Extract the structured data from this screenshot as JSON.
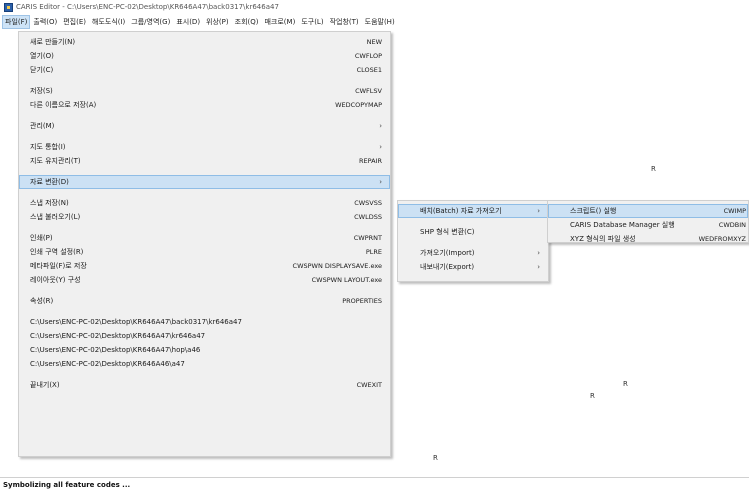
{
  "window": {
    "title": "CARIS Editor - C:\\Users\\ENC-PC-02\\Desktop\\KR646A47\\back0317\\kr646a47"
  },
  "menubar": [
    "파일(F)",
    "출력(O)",
    "편집(E)",
    "해도도식(I)",
    "그룹/영역(G)",
    "표시(D)",
    "위상(P)",
    "조회(Q)",
    "매크로(M)",
    "도구(L)",
    "작업창(T)",
    "도움말(H)"
  ],
  "file_menu": {
    "groups": [
      [
        {
          "label": "새로 만들기(N)",
          "shortcut": "NEW"
        },
        {
          "label": "열기(O)",
          "shortcut": "CWFLOP"
        },
        {
          "label": "닫기(C)",
          "shortcut": "CLOSE1"
        }
      ],
      [
        {
          "label": "저장(S)",
          "shortcut": "CWFLSV"
        },
        {
          "label": "다른 이름으로 저장(A)",
          "shortcut": "WEDCOPYMAP"
        }
      ],
      [
        {
          "label": "관리(M)",
          "shortcut": "",
          "submenu": true
        }
      ],
      [
        {
          "label": "지도 통합(I)",
          "shortcut": "",
          "submenu": true
        },
        {
          "label": "지도 유지관리(T)",
          "shortcut": "REPAIR"
        }
      ],
      [
        {
          "label": "자료 변환(D)",
          "shortcut": "",
          "submenu": true,
          "highlight": true
        }
      ],
      [
        {
          "label": "스냅 저장(N)",
          "shortcut": "CWSVSS"
        },
        {
          "label": "스냅 불러오기(L)",
          "shortcut": "CWLDSS"
        }
      ],
      [
        {
          "label": "인쇄(P)",
          "shortcut": "CWPRNT"
        },
        {
          "label": "인쇄 구역 설정(R)",
          "shortcut": "PLRE"
        },
        {
          "label": "메타파일(F)로 저장",
          "shortcut": "CWSPWN DISPLAYSAVE.exe"
        },
        {
          "label": "레이아웃(Y) 구성",
          "shortcut": "CWSPWN LAYOUT.exe"
        }
      ],
      [
        {
          "label": "속성(R)",
          "shortcut": "PROPERTIES"
        }
      ],
      [
        {
          "label": "C:\\Users\\ENC-PC-02\\Desktop\\KR646A47\\back0317\\kr646a47",
          "shortcut": ""
        },
        {
          "label": "C:\\Users\\ENC-PC-02\\Desktop\\KR646A47\\kr646a47",
          "shortcut": ""
        },
        {
          "label": "C:\\Users\\ENC-PC-02\\Desktop\\KR646A47\\hop\\a46",
          "shortcut": ""
        },
        {
          "label": "C:\\Users\\ENC-PC-02\\Desktop\\KR646A46\\a47",
          "shortcut": ""
        }
      ],
      [
        {
          "label": "끝내기(X)",
          "shortcut": "CWEXIT"
        }
      ]
    ]
  },
  "data_conversion_submenu": {
    "groups": [
      [
        {
          "label": "배치(Batch) 자료 가져오기",
          "submenu": true,
          "highlight": true
        }
      ],
      [
        {
          "label": "SHP 형식 변환(C)",
          "submenu": false
        }
      ],
      [
        {
          "label": "가져오기(Import)",
          "submenu": true
        },
        {
          "label": "내보내기(Export)",
          "submenu": true
        }
      ]
    ]
  },
  "batch_import_submenu": {
    "items": [
      {
        "label": "스크립트() 실행",
        "shortcut": "CWIMP",
        "highlight": true
      },
      {
        "label": "CARIS Database Manager 실행",
        "shortcut": "CWDBIN"
      },
      {
        "label": "XYZ 형식의 파일 생성",
        "shortcut": "WEDFROMXYZ"
      }
    ]
  },
  "canvas_markers": [
    "R",
    "R",
    "R",
    "R"
  ],
  "status": {
    "text": "Symbolizing all feature codes ..."
  }
}
